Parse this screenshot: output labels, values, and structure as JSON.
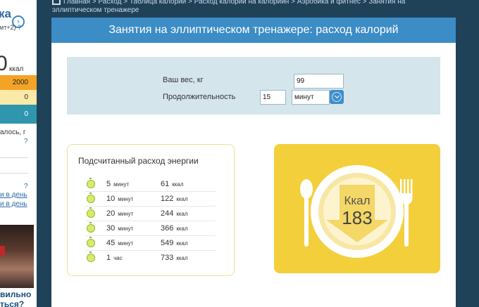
{
  "sidebar": {
    "top_text": "ка",
    "top_sub": "мт+2)",
    "top_q": "?",
    "big_value": "0",
    "kcal": "ккал",
    "row_orange": "2000",
    "row_yellow": "0",
    "row_teal": "0",
    "text1": "алось, г",
    "q": "?",
    "link1": "и в день",
    "link2": "и в день",
    "bottom_text_1": "вильно",
    "bottom_text_2": "ться?"
  },
  "breadcrumb": {
    "line1": "Главная  >  Расход  >  Таблица калорий  >  Расход калорий на калорийн  >  Аэробика и фитнес  >  Занятия на",
    "line2": "эллиптическом тренажере"
  },
  "page": {
    "title": "Занятия на эллиптическом тренажере: расход калорий"
  },
  "form": {
    "weight_label": "Ваш вес, кг",
    "weight_value": "99",
    "duration_label": "Продолжительность",
    "duration_value": "15",
    "unit_selected": "минут"
  },
  "results": {
    "title": "Подсчитанный расход энергии",
    "rows": [
      {
        "num": "5",
        "unit": "минут",
        "kcal": "61",
        "kcal_unit": "ккал"
      },
      {
        "num": "10",
        "unit": "минут",
        "kcal": "122",
        "kcal_unit": "ккал"
      },
      {
        "num": "20",
        "unit": "минут",
        "kcal": "244",
        "kcal_unit": "ккал"
      },
      {
        "num": "30",
        "unit": "минут",
        "kcal": "366",
        "kcal_unit": "ккал"
      },
      {
        "num": "45",
        "unit": "минут",
        "kcal": "549",
        "kcal_unit": "ккал"
      },
      {
        "num": "1",
        "unit": "час",
        "kcal": "733",
        "kcal_unit": "ккал"
      }
    ]
  },
  "plate": {
    "label": "Ккал",
    "value": "183"
  },
  "colors": {
    "header_blue": "#3c8cc6",
    "plate_yellow": "#f4cf3c",
    "background": "#1f4258"
  }
}
